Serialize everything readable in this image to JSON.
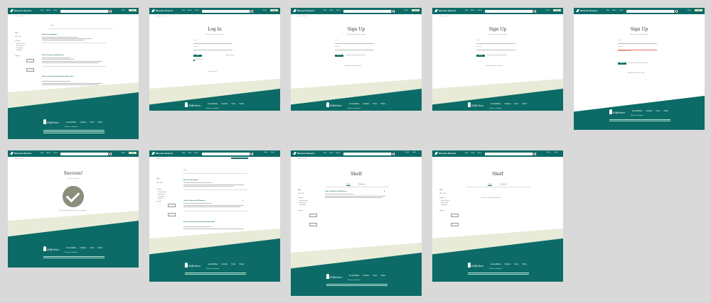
{
  "nav": {
    "brand": "Museum Reports",
    "links": [
      "Map",
      "About",
      "Home"
    ],
    "links_shelf": [
      "Map",
      "Shelf",
      "Home"
    ],
    "user_links": [
      "Shelf",
      "Shelf"
    ],
    "login_label": "Login"
  },
  "breadcrumb": "Home » Search",
  "footer": {
    "logo": "Stiftelsen",
    "links": [
      "Accessibilities",
      "Contacts",
      "Press",
      "Twitter"
    ],
    "social": "Museum on Instagram",
    "copyright": "Lorem ipsum dolor sit amet consectetur adipiscing elit sed do eiusmod"
  },
  "search_page": {
    "search_placeholder": "Search",
    "results_count": "Search results",
    "sidebar": {
      "heading": "Filters",
      "date_label": "Date",
      "date_value": "1800 - 2023",
      "categories_label": "Categories",
      "categories": [
        "Museum Reports",
        "Art Collections",
        "Photography",
        "Exhibitions"
      ],
      "language_label": "Language",
      "reset": "Reset"
    },
    "results": [
      {
        "title": "Museum of Antiquities"
      },
      {
        "title": "Trade of Objects and Wilderness"
      },
      {
        "title": "Science Laboratory Archaeological Excavation"
      }
    ]
  },
  "login": {
    "title": "Log In",
    "subtitle": "Please enter your details to sign in",
    "email_placeholder": "E-mail",
    "password_placeholder": "Password",
    "submit": "Login",
    "forgot": "Forgot password?",
    "remember": "Remember me",
    "signup_link": "Create an account"
  },
  "signup": {
    "title": "Sign Up",
    "subtitle": "Please enter your details to sign up",
    "email_placeholder": "E-mail",
    "password_placeholder": "Password",
    "submit": "Sign Up",
    "terms": "I accept the terms and conditions of use",
    "login_link": "Already have an account? Log in",
    "error": "Password does not match"
  },
  "success": {
    "title": "Success!",
    "subtitle": "You are now registered",
    "message": "Please check your inbox to confirm your email address"
  },
  "shelf": {
    "title": "Shelf",
    "tabs": [
      "Saved",
      "Bookmarks"
    ],
    "item_title": "Trade of Objects and Wilderness",
    "empty_message": "Your shelf is empty. Search to add items"
  },
  "colors": {
    "primary": "#0c6b66",
    "beige": "#e8ebd8",
    "check": "#8d8d7b"
  }
}
